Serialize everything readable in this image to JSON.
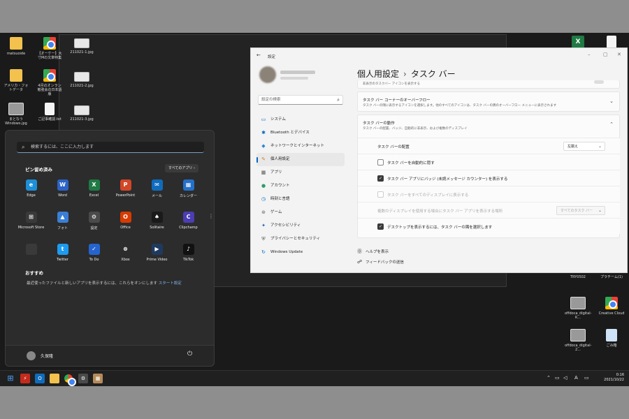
{
  "desktop": {
    "left_icons": [
      {
        "label": "matsuoide",
        "kind": "folder"
      },
      {
        "label": "【オーケー】大寸Mの文章特集",
        "kind": "chrome"
      },
      {
        "label": "211021-1.jpg",
        "kind": "jpg"
      },
      {
        "label": "アメリカ・フォトデータ",
        "kind": "folder"
      },
      {
        "label": "4月のオンラン勉強会の日本語版",
        "kind": "chrome"
      },
      {
        "label": "211021-2.jpg",
        "kind": "jpg"
      },
      {
        "label": "まとなう Windows.jpg",
        "kind": "photo"
      },
      {
        "label": "ご記事確認.txt",
        "kind": "file"
      },
      {
        "label": "211021-3.jpg",
        "kind": "jpg"
      }
    ],
    "right_icons": [
      {
        "label": "TRY0502",
        "kind": "folder"
      },
      {
        "label": "プラチーム(1)",
        "kind": "file"
      },
      {
        "label": "offdoca_digital-K...",
        "kind": "photo"
      },
      {
        "label": "Creative Cloud",
        "kind": "chrome"
      },
      {
        "label": "offdoca_digital-2...",
        "kind": "photo"
      },
      {
        "label": "ごみ箱",
        "kind": "bin"
      }
    ]
  },
  "start_menu": {
    "search_placeholder": "検索するには、ここに入力します",
    "pinned_title": "ピン留め済み",
    "all_apps_label": "すべてのアプリ",
    "apps": [
      {
        "label": "Edge",
        "color": "#1d8fd8",
        "glyph": "e"
      },
      {
        "label": "Word",
        "color": "#2b63c6",
        "glyph": "W"
      },
      {
        "label": "Excel",
        "color": "#1f7a44",
        "glyph": "X"
      },
      {
        "label": "PowerPoint",
        "color": "#d24726",
        "glyph": "P"
      },
      {
        "label": "メール",
        "color": "#0f6cbd",
        "glyph": "✉"
      },
      {
        "label": "カレンダー",
        "color": "#2470c9",
        "glyph": "▦"
      },
      {
        "label": "Microsoft Store",
        "color": "#3a3a3a",
        "glyph": "⊞"
      },
      {
        "label": "フォト",
        "color": "#3a7fd5",
        "glyph": "▲"
      },
      {
        "label": "設定",
        "color": "#4a4a4a",
        "glyph": "⚙"
      },
      {
        "label": "Office",
        "color": "#d83b01",
        "glyph": "O"
      },
      {
        "label": "Solitaire",
        "color": "#1a1a1a",
        "glyph": "♠"
      },
      {
        "label": "Clipchamp",
        "color": "#4b3db3",
        "glyph": "C"
      },
      {
        "label": "",
        "color": "#3a3a3a",
        "glyph": ""
      },
      {
        "label": "Twitter",
        "color": "#1d9bf0",
        "glyph": "t"
      },
      {
        "label": "To Do",
        "color": "#2564cf",
        "glyph": "✓"
      },
      {
        "label": "Xbox",
        "color": "#2c2c2c",
        "glyph": "⊗"
      },
      {
        "label": "Prime Video",
        "color": "#1f3a5f",
        "glyph": "▶"
      },
      {
        "label": "TikTok",
        "color": "#111111",
        "glyph": "♪"
      }
    ],
    "recommended_title": "おすすめ",
    "recommended_text": "最近使ったファイルと新しいアプリを表示するには、これらをオンにします",
    "recommended_link": "スタート設定",
    "user_name": "久保隆"
  },
  "settings": {
    "window_title": "設定",
    "search_placeholder": "設定の検索",
    "nav": [
      {
        "label": "システム",
        "icon": "▭",
        "color": "#0067c0"
      },
      {
        "label": "Bluetooth とデバイス",
        "icon": "✱",
        "color": "#0067c0"
      },
      {
        "label": "ネットワークとインターネット",
        "icon": "◆",
        "color": "#2b88d8"
      },
      {
        "label": "個人用設定",
        "icon": "✎",
        "color": "#d07a2f"
      },
      {
        "label": "アプリ",
        "icon": "▦",
        "color": "#555555"
      },
      {
        "label": "アカウント",
        "icon": "●",
        "color": "#2d9d6b"
      },
      {
        "label": "時刻と言語",
        "icon": "◷",
        "color": "#0067c0"
      },
      {
        "label": "ゲーム",
        "icon": "⊛",
        "color": "#666666"
      },
      {
        "label": "アクセシビリティ",
        "icon": "✦",
        "color": "#1a5fb4"
      },
      {
        "label": "プライバシーとセキュリティ",
        "icon": "⛨",
        "color": "#555555"
      },
      {
        "label": "Windows Update",
        "icon": "↻",
        "color": "#0067c0"
      }
    ],
    "active_nav_index": 3,
    "breadcrumb_parent": "個人用設定",
    "breadcrumb_current": "タスク バー",
    "partial_row": "非表示のタスクバー アイコンを表示する",
    "overflow_title": "タスク バー コーナーのオーバーフロー",
    "overflow_sub": "タスク バーの隅に表示するアイコンを選択します。他のすべてのアイコンは、タスク バーの隅のオーバーフロー メニューに表示されます",
    "behavior_title": "タスク バーの動作",
    "behavior_sub": "タスク バーの配置、バッジ、自動的に非表示、および複数のディスプレイ",
    "alignment_label": "タスク バーの配置",
    "alignment_value": "左揃え",
    "auto_hide_label": "タスク バーを自動的に隠す",
    "badge_label": "タスク バー アプリにバッジ (未読メッセージ カウンター) を表示する",
    "all_displays_label": "タスク バーをすべてのディスプレイに表示する",
    "multi_display_label": "複数のディスプレイを使用する場合にタスク バー アプリを表示する場所",
    "multi_display_value": "すべてのタスク バー",
    "desktop_corner_label": "デスクトップを表示するには、タスク バーの隅を選択します",
    "help_label": "ヘルプを表示",
    "feedback_label": "フィードバックの送信"
  },
  "taskbar": {
    "ime_label": "A",
    "time": "0:16",
    "date": "2021/10/22"
  }
}
